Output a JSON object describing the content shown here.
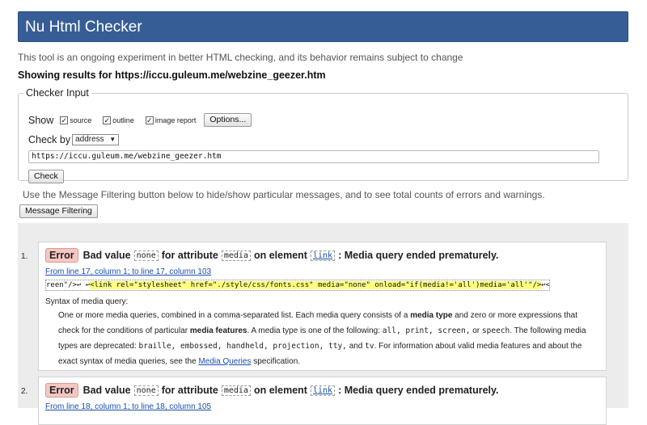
{
  "app": {
    "title": "Nu Html Checker"
  },
  "intro": "This tool is an ongoing experiment in better HTML checking, and its behavior remains subject to change",
  "results_line": "Showing results for https://iccu.guleum.me/webzine_geezer.htm",
  "checker_input": {
    "legend": "Checker Input",
    "show_label": "Show",
    "options": [
      {
        "label": "source",
        "checked": true
      },
      {
        "label": "outline",
        "checked": true
      },
      {
        "label": "image report",
        "checked": true
      }
    ],
    "options_button": "Options...",
    "check_by_label": "Check by",
    "check_by_value": "address",
    "url": "https://iccu.guleum.me/webzine_geezer.htm",
    "check_button": "Check"
  },
  "filter_note": "Use the Message Filtering button below to hide/show particular messages, and to see total counts of errors and warnings.",
  "filter_button": "Message Filtering",
  "messages": [
    {
      "num": "1.",
      "badge": "Error",
      "t1": "Bad value",
      "v1": "none",
      "t2": "for attribute",
      "v2": "media",
      "t3": "on element",
      "v3": "link",
      "t4": ": Media query ended prematurely.",
      "location": "From line 17, column 1; to line 17, column 103",
      "extract_pre": "reen\"/>↩ ↩",
      "extract_hl": "<link rel=\"stylesheet\" href=\"./style/css/fonts.css\" media=\"none\" onload=\"if(media!='all')media='all'\"/>",
      "extract_post": "↩<link",
      "syntax_title": "Syntax of media query:",
      "syntax": {
        "p1": "One or more media queries, combined in a comma-separated list. Each media query consists of a",
        "b1": "media type",
        "p2": "and zero or more expressions that check for the conditions of particular",
        "b2": "media features",
        "p3": ". A media type is one of the following:",
        "types": "all, print, screen,",
        "p4": "or",
        "speech": "speech",
        "p5": ". The following media types are deprecated:",
        "deprecated": "braille, embossed, handheld, projection, tty,",
        "p6": "and",
        "tv": "tv",
        "p7": ". For information about valid media features and about the exact syntax of media queries, see the",
        "link": "Media Queries",
        "p8": "specification."
      }
    },
    {
      "num": "2.",
      "badge": "Error",
      "t1": "Bad value",
      "v1": "none",
      "t2": "for attribute",
      "v2": "media",
      "t3": "on element",
      "v3": "link",
      "t4": ": Media query ended prematurely.",
      "location": "From line 18, column 1; to line 18, column 105"
    }
  ]
}
